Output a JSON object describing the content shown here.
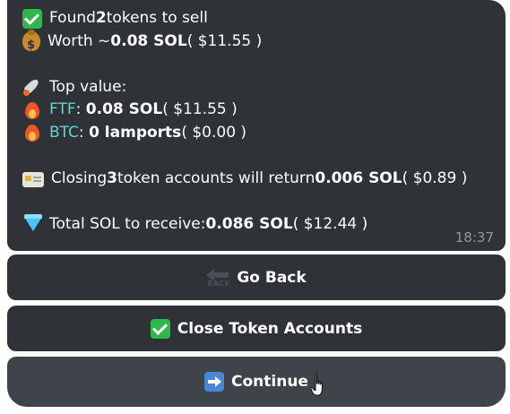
{
  "message": {
    "found_prefix": "Found ",
    "found_count": "2",
    "found_suffix": " tokens to sell",
    "worth_prefix": "Worth ~",
    "worth_sol": "0.08 SOL",
    "worth_usd": " ( $11.55 )",
    "top_value_label": "Top value:",
    "tokens": [
      {
        "ticker": "FTF",
        "amount": "0.08 SOL",
        "usd": " ( $11.55 )"
      },
      {
        "ticker": "BTC",
        "amount": "0 lamports",
        "usd": " ( $0.00 )"
      }
    ],
    "closing_prefix": "Closing ",
    "closing_count": "3",
    "closing_middle": " token accounts will return ",
    "closing_sol": "0.006 SOL",
    "closing_usd": " ( $0.89 )",
    "total_prefix": "Total SOL to receive: ",
    "total_sol": "0.086 SOL",
    "total_usd": " ( $12.44 )",
    "timestamp": "18:37"
  },
  "buttons": {
    "back_label": "Go Back",
    "back_icon_text": "BACK",
    "close_label": "Close Token Accounts",
    "continue_label": "Continue"
  },
  "icons": {
    "found": "check-mark-icon",
    "worth": "money-bag-icon",
    "top_value": "rocket-icon",
    "token": "fire-icon",
    "closing": "id-card-icon",
    "total": "gem-icon",
    "back": "back-arrow-icon",
    "close": "check-mark-icon",
    "continue": "right-arrow-icon"
  },
  "colors": {
    "bubble_bg": "#2f3338",
    "ticker": "#5fd6d2",
    "timestamp": "#8e959d",
    "button_hover_bg": "#3f444b"
  }
}
